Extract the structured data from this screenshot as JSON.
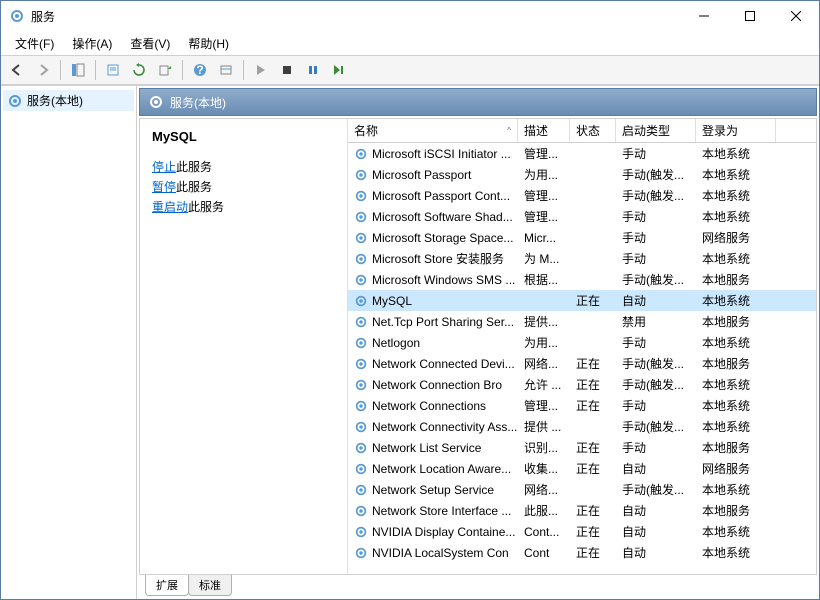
{
  "window": {
    "title": "服务"
  },
  "menu": {
    "file": "文件(F)",
    "action": "操作(A)",
    "view": "查看(V)",
    "help": "帮助(H)"
  },
  "tree": {
    "root": "服务(本地)"
  },
  "contentHeader": "服务(本地)",
  "detail": {
    "title": "MySQL",
    "stop": "停止",
    "stopSuffix": "此服务",
    "pause": "暂停",
    "pauseSuffix": "此服务",
    "restart": "重启动",
    "restartSuffix": "此服务"
  },
  "columns": {
    "name": "名称",
    "desc": "描述",
    "status": "状态",
    "start": "启动类型",
    "logon": "登录为"
  },
  "tabs": {
    "extended": "扩展",
    "standard": "标准"
  },
  "services": [
    {
      "name": "Microsoft iSCSI Initiator ...",
      "desc": "管理...",
      "status": "",
      "start": "手动",
      "logon": "本地系统"
    },
    {
      "name": "Microsoft Passport",
      "desc": "为用...",
      "status": "",
      "start": "手动(触发...",
      "logon": "本地系统"
    },
    {
      "name": "Microsoft Passport Cont...",
      "desc": "管理...",
      "status": "",
      "start": "手动(触发...",
      "logon": "本地系统"
    },
    {
      "name": "Microsoft Software Shad...",
      "desc": "管理...",
      "status": "",
      "start": "手动",
      "logon": "本地系统"
    },
    {
      "name": "Microsoft Storage Space...",
      "desc": "Micr...",
      "status": "",
      "start": "手动",
      "logon": "网络服务"
    },
    {
      "name": "Microsoft Store 安装服务",
      "desc": "为 M...",
      "status": "",
      "start": "手动",
      "logon": "本地系统"
    },
    {
      "name": "Microsoft Windows SMS ...",
      "desc": "根据...",
      "status": "",
      "start": "手动(触发...",
      "logon": "本地服务"
    },
    {
      "name": "MySQL",
      "desc": "",
      "status": "正在",
      "start": "自动",
      "logon": "本地系统",
      "selected": true
    },
    {
      "name": "Net.Tcp Port Sharing Ser...",
      "desc": "提供...",
      "status": "",
      "start": "禁用",
      "logon": "本地服务"
    },
    {
      "name": "Netlogon",
      "desc": "为用...",
      "status": "",
      "start": "手动",
      "logon": "本地系统"
    },
    {
      "name": "Network Connected Devi...",
      "desc": "网络...",
      "status": "正在",
      "start": "手动(触发...",
      "logon": "本地服务"
    },
    {
      "name": "Network Connection Bro",
      "desc": "允许 ...",
      "status": "正在",
      "start": "手动(触发...",
      "logon": "本地系统"
    },
    {
      "name": "Network Connections",
      "desc": "管理...",
      "status": "正在",
      "start": "手动",
      "logon": "本地系统"
    },
    {
      "name": "Network Connectivity Ass...",
      "desc": "提供 ...",
      "status": "",
      "start": "手动(触发...",
      "logon": "本地系统"
    },
    {
      "name": "Network List Service",
      "desc": "识别...",
      "status": "正在",
      "start": "手动",
      "logon": "本地服务"
    },
    {
      "name": "Network Location Aware...",
      "desc": "收集...",
      "status": "正在",
      "start": "自动",
      "logon": "网络服务"
    },
    {
      "name": "Network Setup Service",
      "desc": "网络...",
      "status": "",
      "start": "手动(触发...",
      "logon": "本地系统"
    },
    {
      "name": "Network Store Interface ...",
      "desc": "此服...",
      "status": "正在",
      "start": "自动",
      "logon": "本地服务"
    },
    {
      "name": "NVIDIA Display Containe...",
      "desc": "Cont...",
      "status": "正在",
      "start": "自动",
      "logon": "本地系统"
    },
    {
      "name": "NVIDIA LocalSystem Con",
      "desc": "Cont",
      "status": "正在",
      "start": "自动",
      "logon": "本地系统"
    }
  ]
}
